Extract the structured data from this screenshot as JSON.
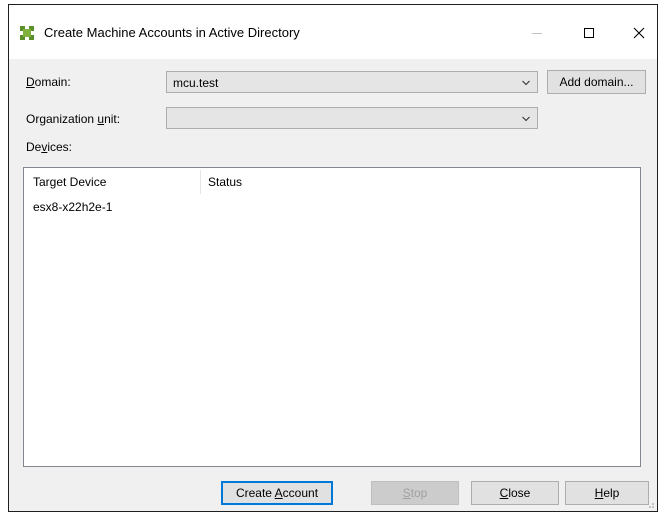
{
  "window": {
    "title": "Create Machine Accounts in Active Directory",
    "controls": {
      "minimize": "minimize",
      "maximize": "maximize",
      "close": "close"
    }
  },
  "form": {
    "domain_label": {
      "pre": "",
      "key": "D",
      "post": "omain:"
    },
    "domain_value": "mcu.test",
    "add_domain_label": "Add domain...",
    "ou_label": {
      "pre": "Organization ",
      "key": "u",
      "post": "nit:"
    },
    "ou_value": "",
    "devices_label": {
      "pre": "De",
      "key": "v",
      "post": "ices:"
    }
  },
  "devices_table": {
    "columns": [
      "Target Device",
      "Status"
    ],
    "rows": [
      {
        "target_device": "esx8-x22h2e-1",
        "status": ""
      }
    ]
  },
  "buttons": {
    "create_account": {
      "pre": "Create ",
      "key": "A",
      "post": "ccount"
    },
    "stop": {
      "pre": "",
      "key": "S",
      "post": "top"
    },
    "close": {
      "pre": "",
      "key": "C",
      "post": "lose"
    },
    "help": {
      "pre": "",
      "key": "H",
      "post": "elp"
    }
  },
  "colors": {
    "accent": "#0078d7",
    "app_icon": "#5a8f29"
  },
  "icons": [
    "app-icon",
    "minimize-icon",
    "maximize-icon",
    "close-icon",
    "chevron-down-icon",
    "resize-grip-icon"
  ]
}
